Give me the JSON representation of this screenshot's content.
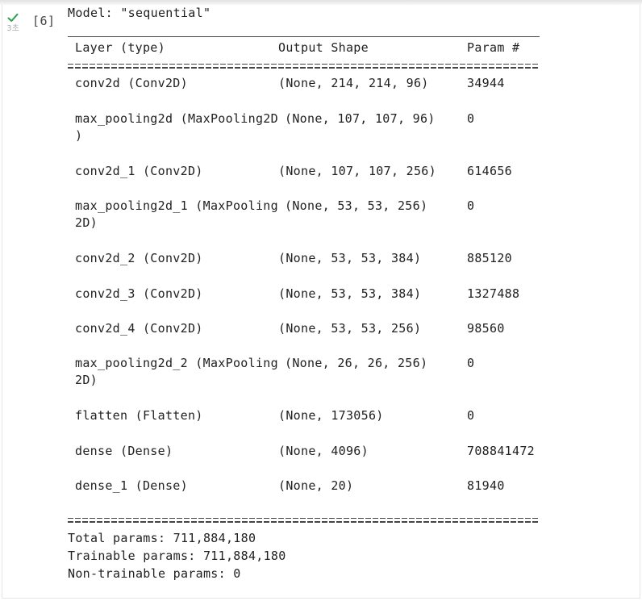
{
  "cell": {
    "execution_count": "[6]",
    "elapsed": "3초",
    "status_icon": "checkmark-icon",
    "status_color": "#2e9f4a"
  },
  "output": {
    "model_line": "Model: \"sequential\"",
    "headers": {
      "layer": "Layer (type)",
      "shape": "Output Shape",
      "param": "Param #"
    },
    "rows": [
      {
        "layer": "conv2d (Conv2D)",
        "layer_cont": "",
        "shape": "(None, 214, 214, 96)",
        "param": "34944"
      },
      {
        "layer": "max_pooling2d (MaxPooling2D",
        "layer_cont": ")",
        "shape": "(None, 107, 107, 96)",
        "param": "0"
      },
      {
        "layer": "conv2d_1 (Conv2D)",
        "layer_cont": "",
        "shape": "(None, 107, 107, 256)",
        "param": "614656"
      },
      {
        "layer": "max_pooling2d_1 (MaxPooling",
        "layer_cont": "2D)",
        "shape": "(None, 53, 53, 256)",
        "param": "0"
      },
      {
        "layer": "conv2d_2 (Conv2D)",
        "layer_cont": "",
        "shape": "(None, 53, 53, 384)",
        "param": "885120"
      },
      {
        "layer": "conv2d_3 (Conv2D)",
        "layer_cont": "",
        "shape": "(None, 53, 53, 384)",
        "param": "1327488"
      },
      {
        "layer": "conv2d_4 (Conv2D)",
        "layer_cont": "",
        "shape": "(None, 53, 53, 256)",
        "param": "98560"
      },
      {
        "layer": "max_pooling2d_2 (MaxPooling",
        "layer_cont": "2D)",
        "shape": "(None, 26, 26, 256)",
        "param": "0"
      },
      {
        "layer": "flatten (Flatten)",
        "layer_cont": "",
        "shape": "(None, 173056)",
        "param": "0"
      },
      {
        "layer": "dense (Dense)",
        "layer_cont": "",
        "shape": "(None, 4096)",
        "param": "708841472"
      },
      {
        "layer": "dense_1 (Dense)",
        "layer_cont": "",
        "shape": "(None, 20)",
        "param": "81940"
      }
    ],
    "total_params": "Total params: 711,884,180",
    "trainable_params": "Trainable params: 711,884,180",
    "non_trainable_params": "Non-trainable params: 0"
  }
}
